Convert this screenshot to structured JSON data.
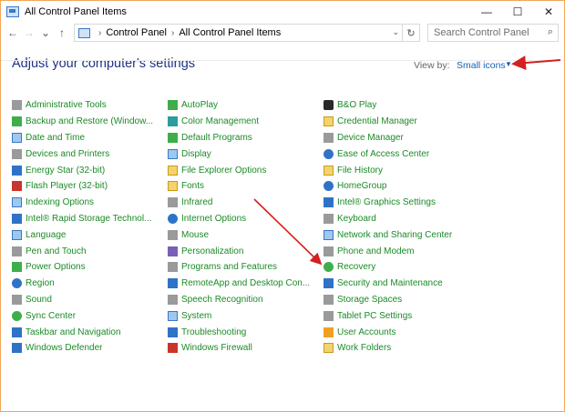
{
  "window": {
    "title": "All Control Panel Items"
  },
  "titlebar": {
    "minimize": "—",
    "maximize": "☐",
    "close": "✕"
  },
  "nav": {
    "back": "←",
    "forward": "→",
    "recent": "⌄",
    "up": "↑"
  },
  "address": {
    "crumbs": [
      "Control Panel",
      "All Control Panel Items"
    ],
    "refresh": "↻"
  },
  "search": {
    "placeholder": "Search Control Panel"
  },
  "header": {
    "heading": "Adjust your computer's settings",
    "view_by_label": "View by:",
    "view_by_value": "Small icons"
  },
  "colors": {
    "accent_link": "#1b8a27",
    "heading": "#1e3287",
    "arrow": "#d42020"
  },
  "columns": [
    [
      {
        "label": "Administrative Tools",
        "icon": "admin-tools-icon"
      },
      {
        "label": "Backup and Restore (Window...",
        "icon": "backup-icon"
      },
      {
        "label": "Date and Time",
        "icon": "clock-icon"
      },
      {
        "label": "Devices and Printers",
        "icon": "printer-icon"
      },
      {
        "label": "Energy Star (32-bit)",
        "icon": "energy-star-icon"
      },
      {
        "label": "Flash Player (32-bit)",
        "icon": "flash-icon"
      },
      {
        "label": "Indexing Options",
        "icon": "indexing-icon"
      },
      {
        "label": "Intel® Rapid Storage Technol...",
        "icon": "intel-storage-icon"
      },
      {
        "label": "Language",
        "icon": "language-icon"
      },
      {
        "label": "Pen and Touch",
        "icon": "pen-icon"
      },
      {
        "label": "Power Options",
        "icon": "power-icon"
      },
      {
        "label": "Region",
        "icon": "globe-icon"
      },
      {
        "label": "Sound",
        "icon": "speaker-icon"
      },
      {
        "label": "Sync Center",
        "icon": "sync-icon"
      },
      {
        "label": "Taskbar and Navigation",
        "icon": "taskbar-icon"
      },
      {
        "label": "Windows Defender",
        "icon": "shield-icon"
      }
    ],
    [
      {
        "label": "AutoPlay",
        "icon": "autoplay-icon"
      },
      {
        "label": "Color Management",
        "icon": "color-management-icon"
      },
      {
        "label": "Default Programs",
        "icon": "default-programs-icon"
      },
      {
        "label": "Display",
        "icon": "monitor-icon"
      },
      {
        "label": "File Explorer Options",
        "icon": "folder-icon"
      },
      {
        "label": "Fonts",
        "icon": "fonts-icon"
      },
      {
        "label": "Infrared",
        "icon": "infrared-icon"
      },
      {
        "label": "Internet Options",
        "icon": "internet-icon"
      },
      {
        "label": "Mouse",
        "icon": "mouse-icon"
      },
      {
        "label": "Personalization",
        "icon": "personalization-icon"
      },
      {
        "label": "Programs and Features",
        "icon": "programs-icon"
      },
      {
        "label": "RemoteApp and Desktop Con...",
        "icon": "remoteapp-icon"
      },
      {
        "label": "Speech Recognition",
        "icon": "microphone-icon"
      },
      {
        "label": "System",
        "icon": "system-icon"
      },
      {
        "label": "Troubleshooting",
        "icon": "troubleshoot-icon"
      },
      {
        "label": "Windows Firewall",
        "icon": "firewall-icon"
      }
    ],
    [
      {
        "label": "B&O Play",
        "icon": "bo-play-icon"
      },
      {
        "label": "Credential Manager",
        "icon": "credential-icon"
      },
      {
        "label": "Device Manager",
        "icon": "device-manager-icon"
      },
      {
        "label": "Ease of Access Center",
        "icon": "ease-of-access-icon"
      },
      {
        "label": "File History",
        "icon": "file-history-icon"
      },
      {
        "label": "HomeGroup",
        "icon": "homegroup-icon"
      },
      {
        "label": "Intel® Graphics Settings",
        "icon": "intel-graphics-icon"
      },
      {
        "label": "Keyboard",
        "icon": "keyboard-icon"
      },
      {
        "label": "Network and Sharing Center",
        "icon": "network-icon"
      },
      {
        "label": "Phone and Modem",
        "icon": "phone-icon"
      },
      {
        "label": "Recovery",
        "icon": "recovery-icon"
      },
      {
        "label": "Security and Maintenance",
        "icon": "flag-icon"
      },
      {
        "label": "Storage Spaces",
        "icon": "storage-icon"
      },
      {
        "label": "Tablet PC Settings",
        "icon": "tablet-icon"
      },
      {
        "label": "User Accounts",
        "icon": "users-icon"
      },
      {
        "label": "Work Folders",
        "icon": "work-folders-icon"
      }
    ]
  ]
}
